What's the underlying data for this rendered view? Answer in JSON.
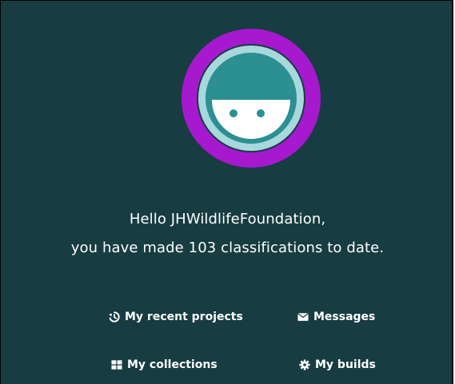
{
  "profile": {
    "username": "JHWildlifeFoundation",
    "classification_count": 103,
    "greeting_line1": "Hello JHWildlifeFoundation,",
    "greeting_line2": "you have made 103 classifications to date."
  },
  "avatar": {
    "icon": "smiley-robot-avatar",
    "ring_color": "#a619cf",
    "inner_ring_color": "#a6d8dc",
    "face_color": "#2c8f91",
    "mouth_color": "#ffffff",
    "eye_color": "#2c8f91"
  },
  "links": {
    "recent_projects": {
      "label": "My recent projects",
      "icon": "history-icon"
    },
    "messages": {
      "label": "Messages",
      "icon": "envelope-icon"
    },
    "collections": {
      "label": "My collections",
      "icon": "grid-icon"
    },
    "builds": {
      "label": "My builds",
      "icon": "gear-icon"
    }
  },
  "colors": {
    "background": "#173c42",
    "text": "#ffffff"
  }
}
